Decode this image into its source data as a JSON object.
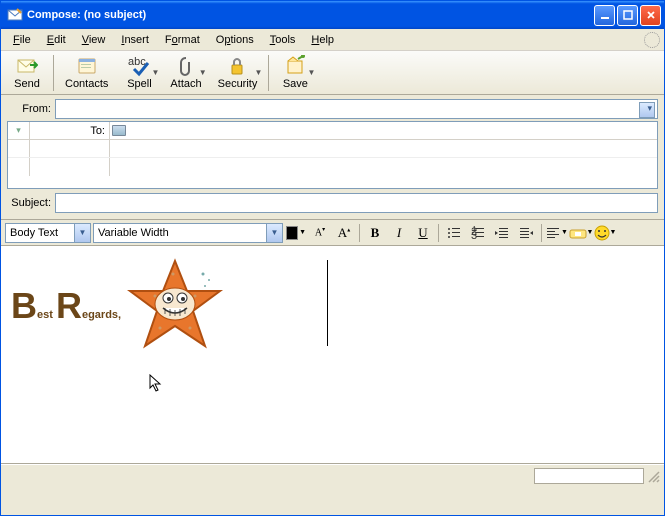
{
  "window": {
    "title": "Compose: (no subject)"
  },
  "menu": {
    "file": "File",
    "edit": "Edit",
    "view": "View",
    "insert": "Insert",
    "format": "Format",
    "options": "Options",
    "tools": "Tools",
    "help": "Help"
  },
  "toolbar": {
    "send": "Send",
    "contacts": "Contacts",
    "spell": "Spell",
    "attach": "Attach",
    "security": "Security",
    "save": "Save"
  },
  "headers": {
    "from_label": "From:",
    "from_value": "",
    "to_label": "To:",
    "to_value": "",
    "subject_label": "Subject:",
    "subject_value": ""
  },
  "format": {
    "paragraph_style": "Body Text",
    "font_family": "Variable Width",
    "bold": "B",
    "italic": "I",
    "underline": "U"
  },
  "body": {
    "signature_text": "Best Regards,"
  },
  "icons": {
    "app": "compose-icon",
    "minimize": "minimize-icon",
    "maximize": "maximize-icon",
    "close": "close-icon",
    "send": "send-icon",
    "contacts": "contacts-icon",
    "spell": "spell-icon",
    "attach": "attach-icon",
    "security": "security-icon",
    "save": "save-icon",
    "text_color": "text-color-icon",
    "smaller": "smaller-font-icon",
    "larger": "larger-font-icon",
    "ul": "bullet-list-icon",
    "ol": "number-list-icon",
    "outdent": "outdent-icon",
    "indent": "indent-icon",
    "align": "align-icon",
    "link": "insert-link-icon",
    "smiley": "smiley-icon",
    "addressbook": "addressbook-icon",
    "starfish": "starfish-image"
  }
}
